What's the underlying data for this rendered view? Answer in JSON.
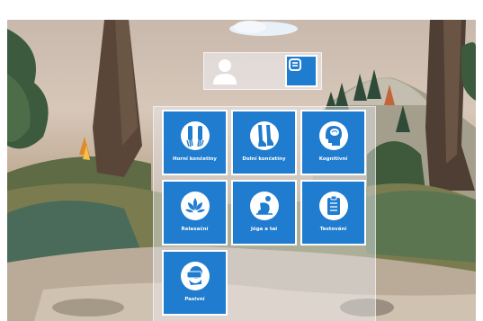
{
  "user_panel": {
    "avatar_icon": "user-avatar-icon",
    "logout_icon": "logout-icon"
  },
  "menu": {
    "tiles": [
      {
        "label": "Horní končetiny",
        "icon": "upper-limbs-icon"
      },
      {
        "label": "Dolní končetiny",
        "icon": "lower-limbs-icon"
      },
      {
        "label": "Kognitivní",
        "icon": "brain-head-icon"
      },
      {
        "label": "Relaxační",
        "icon": "lotus-icon"
      },
      {
        "label": "Jóga a tai",
        "icon": "yoga-pose-icon"
      },
      {
        "label": "Testování",
        "icon": "clipboard-icon"
      },
      {
        "label": "Pasivní",
        "icon": "vr-headset-icon"
      }
    ]
  },
  "colors": {
    "tile_blue": "#1f7ccf",
    "tile_border": "#ffffff"
  }
}
